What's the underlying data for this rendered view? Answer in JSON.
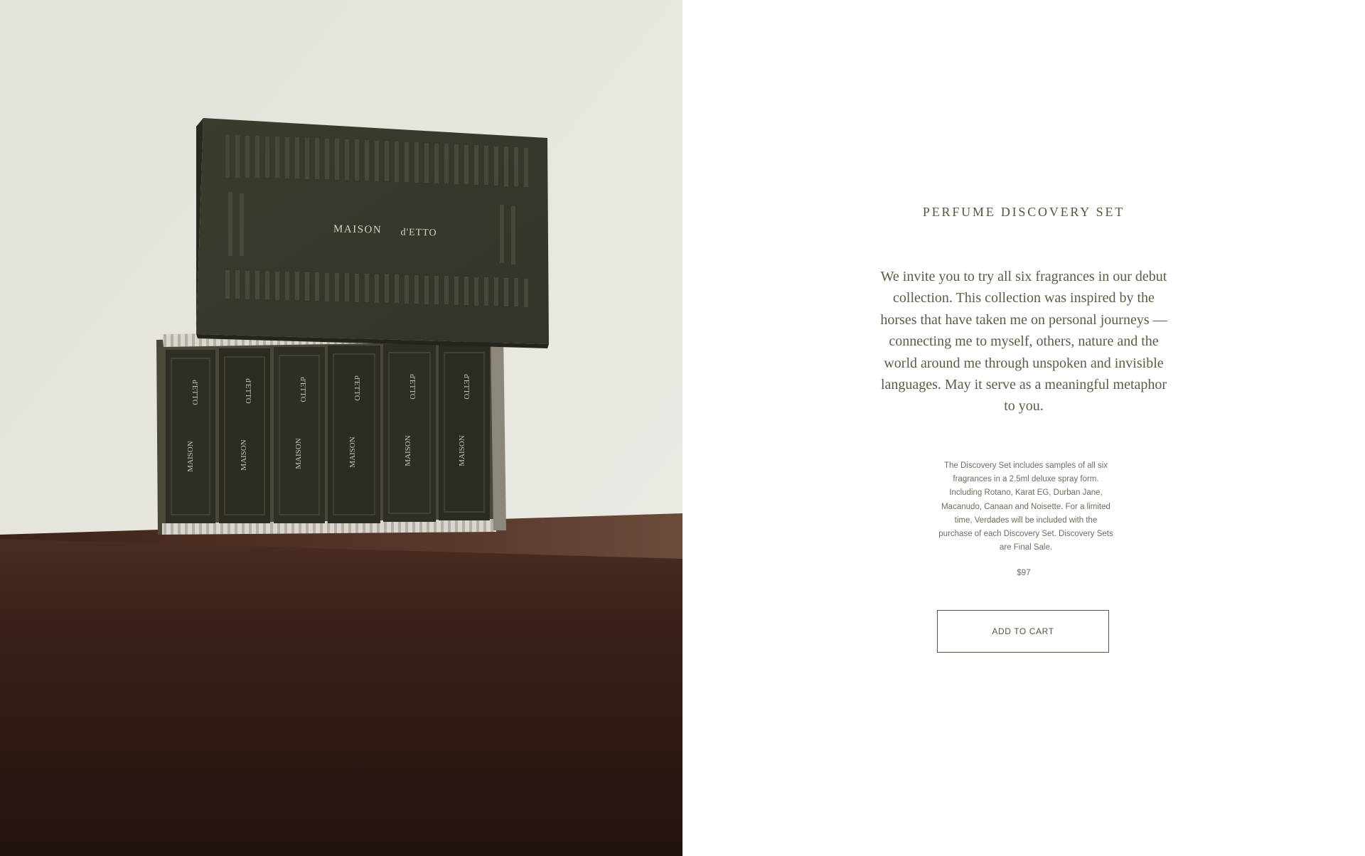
{
  "product": {
    "title": "PERFUME DISCOVERY SET",
    "intro": "We invite you to try all six fragrances in our debut collection. This collection was inspired by the horses that have taken me on personal journeys — connecting me to myself, others, nature and the world around me through unspoken and invisible languages. May it serve as a meaningful metaphor to you.",
    "details": "The Discovery Set includes samples of all six fragrances in a 2.5ml deluxe spray form. Including Rotano, Karat EG, Durban Jane, Macanudo, Canaan and Noisette.   For a limited time, Verdades will be included with the purchase of each Discovery Set.   Discovery Sets are Final Sale.",
    "price": "$97",
    "add_to_cart_label": "ADD TO CART"
  },
  "photo": {
    "box_lid_brand_left": "MAISON",
    "box_lid_brand_right": "d'ETTO",
    "vial_brand_top": "d'ETTO",
    "vial_brand_bottom": "MAISON",
    "vial_count": 6
  },
  "colors": {
    "accent": "#55563f",
    "box_green": "#3a392c",
    "wall": "#e6e4dc",
    "wood": "#3a2219"
  }
}
